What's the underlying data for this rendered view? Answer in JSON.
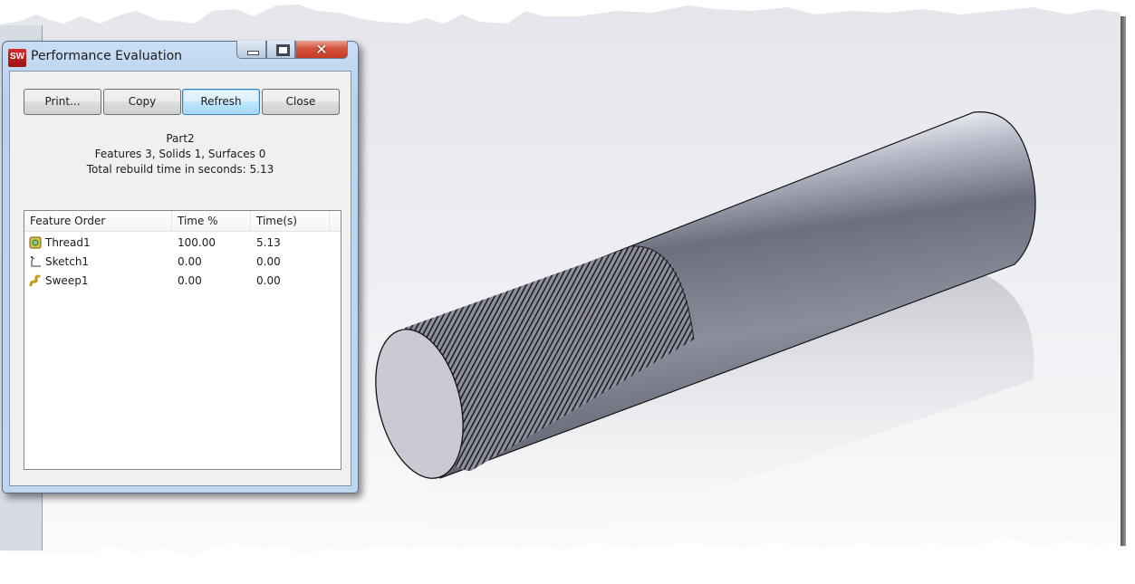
{
  "window": {
    "title": "Performance Evaluation",
    "app_icon_label": "SW",
    "caption_buttons": {
      "minimize": "minimize",
      "maximize": "maximize",
      "close": "✕"
    }
  },
  "toolbar": {
    "print_label": "Print...",
    "copy_label": "Copy",
    "refresh_label": "Refresh",
    "close_label": "Close"
  },
  "summary": {
    "part_name": "Part2",
    "counts": "Features 3, Solids 1, Surfaces 0",
    "rebuild_time": "Total rebuild time in seconds: 5.13"
  },
  "table": {
    "columns": [
      "Feature Order",
      "Time %",
      "Time(s)"
    ],
    "rows": [
      {
        "icon": "thread-feature-icon",
        "name": "Thread1",
        "time_pct": "100.00",
        "time_s": "5.13"
      },
      {
        "icon": "sketch-feature-icon",
        "name": "Sketch1",
        "time_pct": "0.00",
        "time_s": "0.00"
      },
      {
        "icon": "sweep-feature-icon",
        "name": "Sweep1",
        "time_pct": "0.00",
        "time_s": "0.00"
      }
    ]
  },
  "viewport": {
    "model": "threaded cylindrical rod",
    "model_color": "#7b7f8e",
    "background_top": "#e4e6ec",
    "background_bottom": "#fbfbfc"
  }
}
